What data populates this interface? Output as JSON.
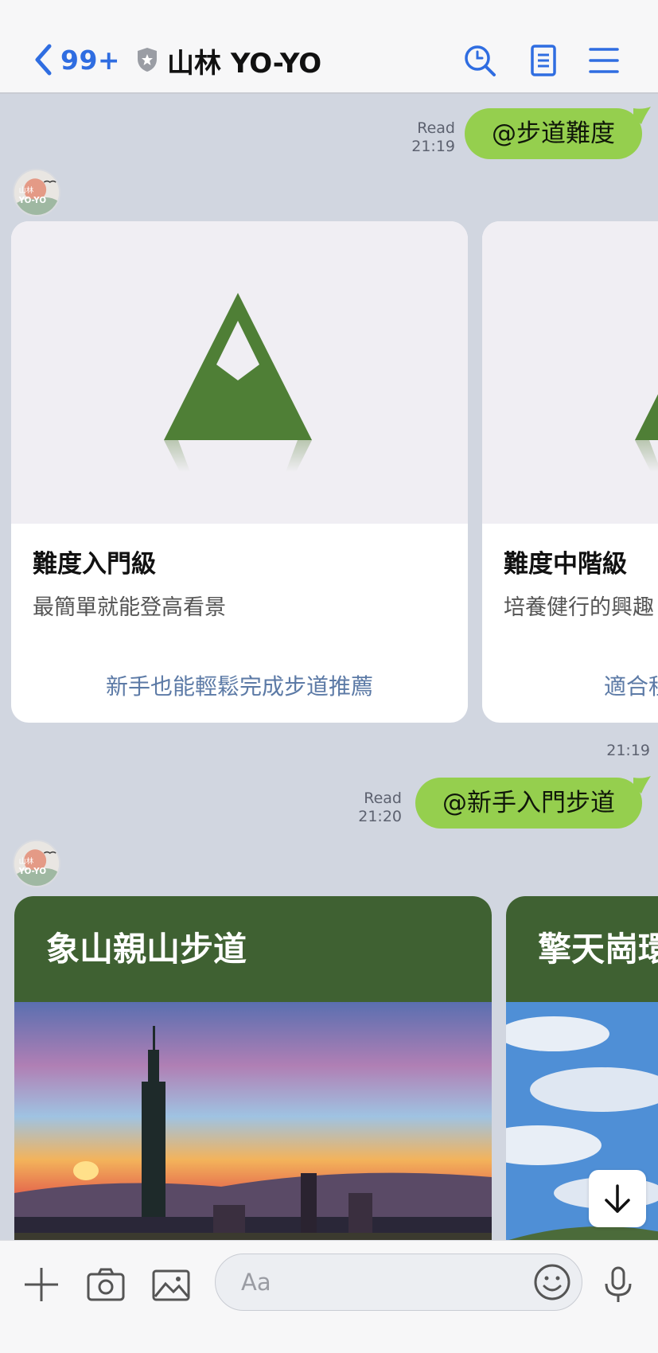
{
  "header": {
    "back_count": "99+",
    "title": "山林 YO-YO"
  },
  "messages": {
    "out1": {
      "text": "@步道難度",
      "read": "Read",
      "time": "21:19"
    },
    "cards1": [
      {
        "title": "難度入門級",
        "desc": "最簡單就能登高看景",
        "link": "新手也能輕鬆完成步道推薦"
      },
      {
        "title": "難度中階級",
        "desc": "培養健行的興趣",
        "link": "適合程"
      }
    ],
    "cards1_time": "21:19",
    "out2": {
      "text": "@新手入門步道",
      "read": "Read",
      "time": "21:20"
    },
    "trails": [
      {
        "title": "象山親山步道"
      },
      {
        "title": "擎天崗環"
      }
    ],
    "avatar_text": "山林 YO-YO"
  },
  "composer": {
    "placeholder": "Aa"
  },
  "colors": {
    "accent": "#2f6de1",
    "bubble_out": "#95cf4e",
    "mountain_green": "#4f7f36",
    "trail_header": "#3f6132",
    "chat_bg": "#d1d6e0"
  },
  "icons": {
    "back": "chevron-left-icon",
    "shield": "shield-icon",
    "search": "search-icon",
    "notes": "notes-icon",
    "menu": "menu-icon",
    "plus": "plus-icon",
    "camera": "camera-icon",
    "image": "image-icon",
    "emoji": "emoji-icon",
    "mic": "microphone-icon",
    "scroll_down": "arrow-down-icon"
  }
}
